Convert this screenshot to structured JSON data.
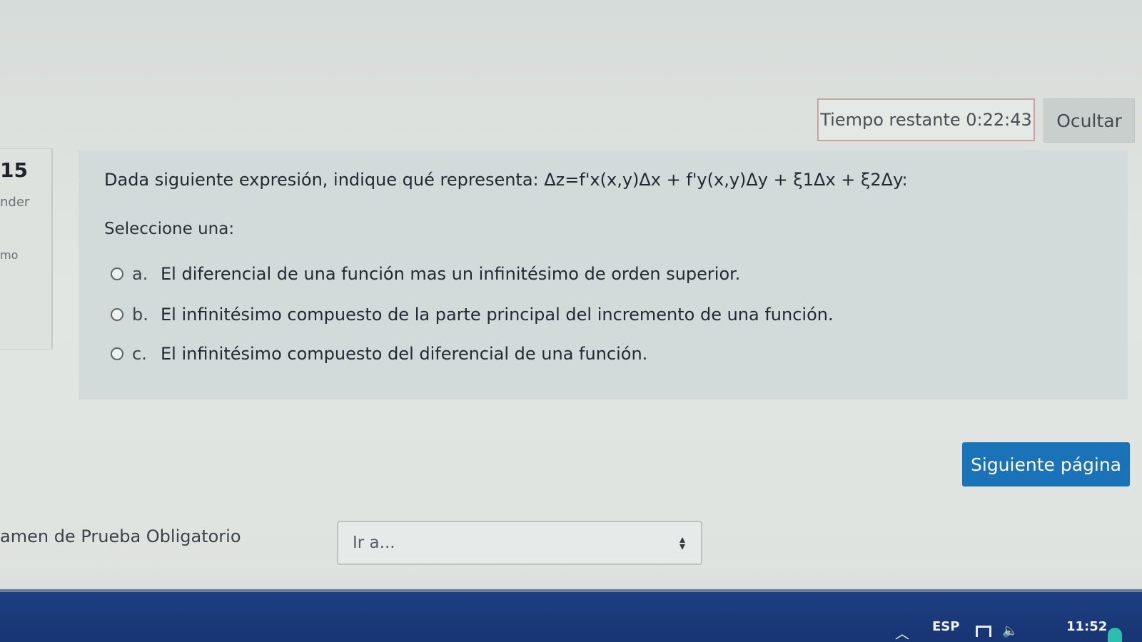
{
  "timer": {
    "label": "Tiempo restante 0:22:43",
    "hide_label": "Ocultar"
  },
  "question": {
    "number": "15",
    "info_line1": "nder",
    "info_line2": "mo",
    "text": "Dada siguiente expresión, indique qué representa: Δz=f'x(x,y)Δx + f'y(x,y)Δy + ξ1Δx + ξ2Δy:",
    "prompt": "Seleccione una:",
    "options": [
      {
        "letter": "a.",
        "text": "El diferencial de una función mas un infinitésimo de orden superior."
      },
      {
        "letter": "b.",
        "text": "El infinitésimo compuesto de la parte principal del incremento de una función."
      },
      {
        "letter": "c.",
        "text": "El infinitésimo compuesto del diferencial de una función."
      }
    ]
  },
  "navigation": {
    "next_label": "Siguiente página",
    "exam_name": "amen de Prueba Obligatorio",
    "jump_placeholder": "Ir a..."
  },
  "taskbar": {
    "language": "ESP",
    "time": "11:52"
  },
  "colors": {
    "primary_button": "#1a73b8",
    "question_panel": "#d3dada",
    "taskbar": "#1e3f82"
  }
}
